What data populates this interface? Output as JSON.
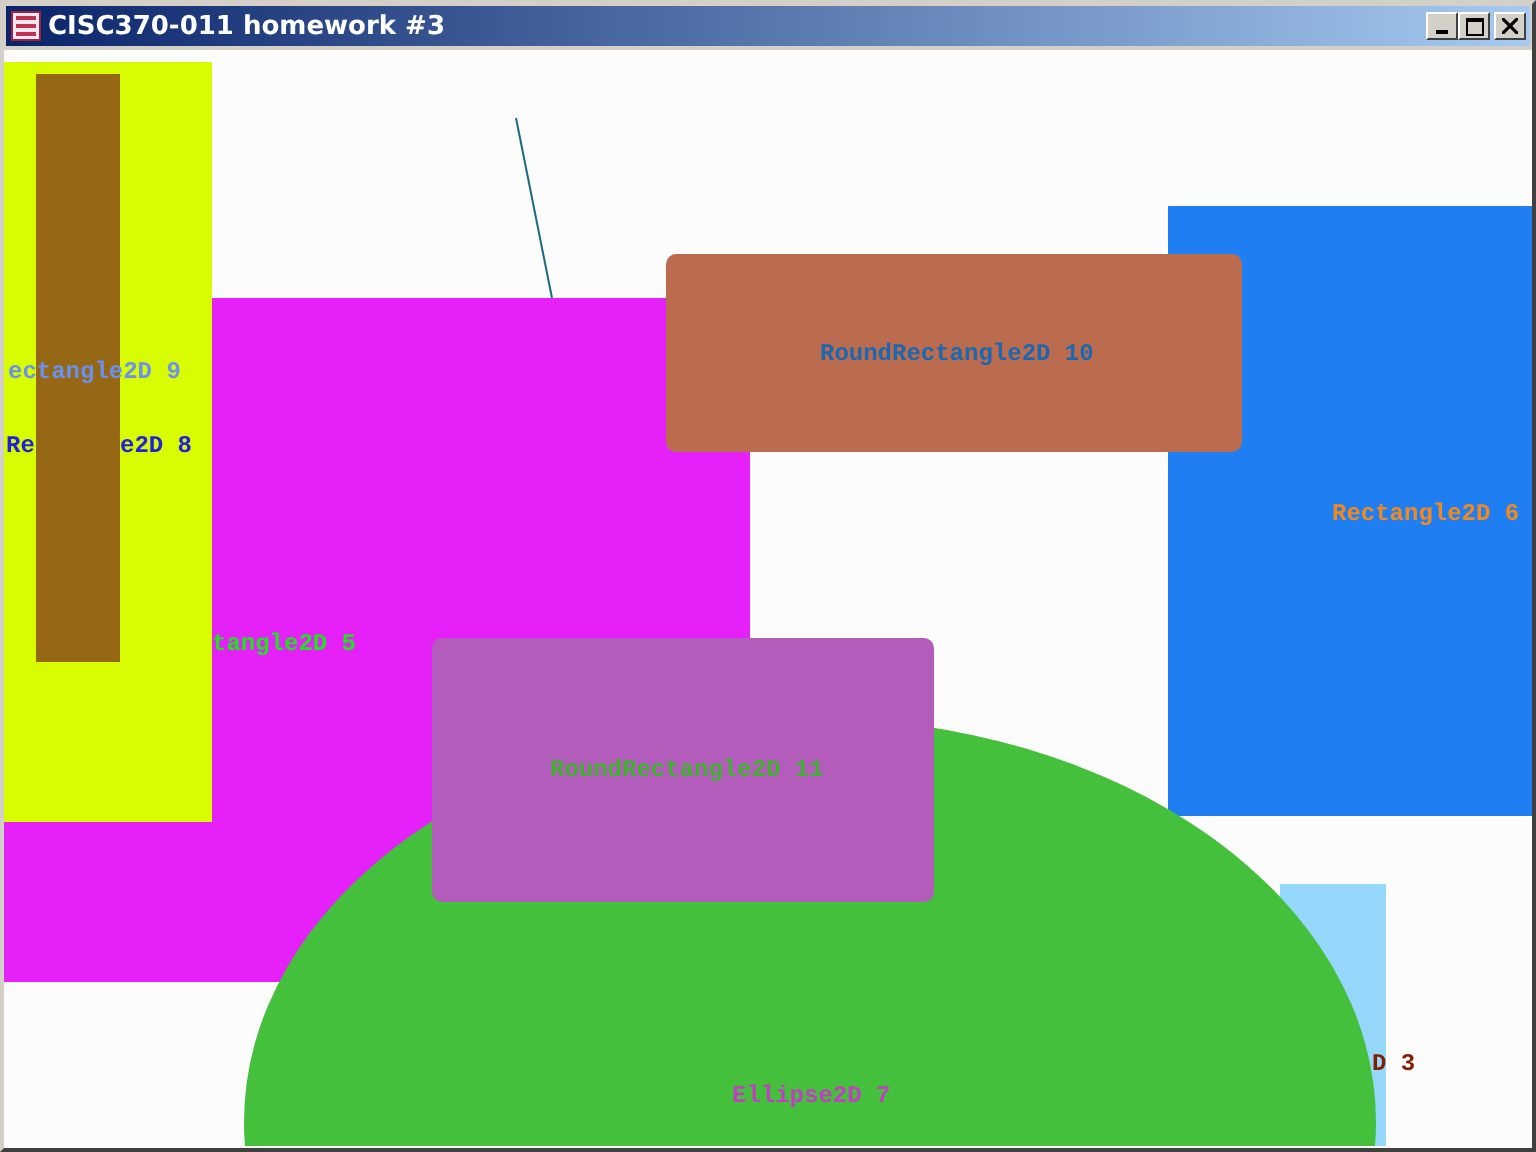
{
  "window": {
    "title": "CISC370-011 homework #3"
  },
  "shapes": [
    {
      "kind": "line",
      "color": "#1a6a80"
    },
    {
      "kind": "rect",
      "color": "#e620f8",
      "labels": [
        {
          "text": "tangle2D 5",
          "color": "#20e020"
        }
      ]
    },
    {
      "kind": "rect",
      "color": "#d8fc00",
      "labels": [
        {
          "text": "Re",
          "color": "#2020e0"
        },
        {
          "text": "e2D 8",
          "color": "#2020e0"
        }
      ]
    },
    {
      "kind": "rect",
      "color": "#966714",
      "labels": [
        {
          "text": "ectangle2D 9",
          "color": "#6a90f0"
        }
      ]
    },
    {
      "kind": "rect",
      "color": "#1e7ef2",
      "labels": [
        {
          "text": "Rectangle2D 6",
          "color": "#f08a20"
        }
      ]
    },
    {
      "kind": "roundrect",
      "color": "#bc6c4e",
      "labels": [
        {
          "text": "RoundRectangle2D 10",
          "color": "#1c68b0"
        }
      ]
    },
    {
      "kind": "rect",
      "color": "#96d8fc",
      "labels": [
        {
          "text": "D 3",
          "color": "#802000"
        }
      ]
    },
    {
      "kind": "ellipse",
      "color": "#44c03c",
      "labels": [
        {
          "text": "Ellipse2D 7",
          "color": "#c040c0"
        }
      ]
    },
    {
      "kind": "roundrect",
      "color": "#b45cbc",
      "labels": [
        {
          "text": "RoundRectangle2D 11",
          "color": "#40b030"
        }
      ]
    }
  ]
}
